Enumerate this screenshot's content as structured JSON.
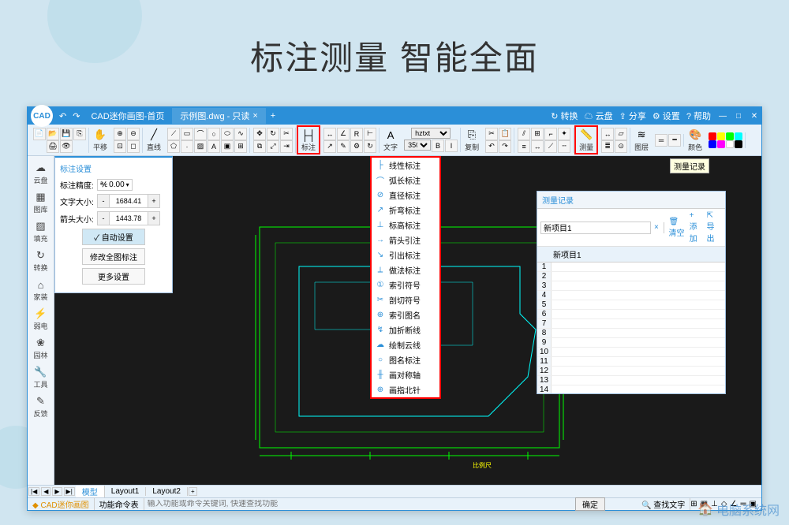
{
  "headline": "标注测量 智能全面",
  "titlebar": {
    "nav_back": "↶",
    "nav_fwd": "↷",
    "tab1": "CAD迷你画图-首页",
    "tab2": "示例图.dwg - 只读",
    "close": "×",
    "tools": {
      "convert": "↻ 转换",
      "cloud": "☁ 云盘",
      "share": "⇪ 分享",
      "settings": "⚙ 设置",
      "help": "? 帮助"
    },
    "win": {
      "min": "—",
      "max": "□",
      "close": "✕"
    }
  },
  "ribbon": {
    "pan": "平移",
    "line": "直线",
    "annotate": "标注",
    "text": "文字",
    "font": "hztxt",
    "size": "350",
    "bold": "B",
    "italic": "I",
    "copy": "复制",
    "measure": "测量",
    "layer": "图层",
    "color": "颜色"
  },
  "sidebar": {
    "items": [
      {
        "icon": "☁",
        "label": "云盘"
      },
      {
        "icon": "▦",
        "label": "图库"
      },
      {
        "icon": "▨",
        "label": "填充"
      },
      {
        "icon": "↻",
        "label": "转换"
      },
      {
        "icon": "⌂",
        "label": "家装"
      },
      {
        "icon": "⚡",
        "label": "弱电"
      },
      {
        "icon": "❀",
        "label": "园林"
      },
      {
        "icon": "🔧",
        "label": "工具"
      },
      {
        "icon": "✎",
        "label": "反馈"
      }
    ]
  },
  "settings_panel": {
    "title": "标注设置",
    "precision_label": "标注精度:",
    "precision_value": "0.00",
    "text_size_label": "文字大小:",
    "text_size_value": "1684.41",
    "arrow_size_label": "箭头大小:",
    "arrow_size_value": "1443.78",
    "auto": "✓ 自动设置",
    "modify": "修改全图标注",
    "more": "更多设置"
  },
  "dropdown": {
    "items": [
      {
        "icon": "├",
        "label": "线性标注"
      },
      {
        "icon": "⌒",
        "label": "弧长标注"
      },
      {
        "icon": "⊘",
        "label": "直径标注"
      },
      {
        "icon": "↗",
        "label": "折弯标注"
      },
      {
        "icon": "⊥",
        "label": "标高标注"
      },
      {
        "icon": "→",
        "label": "箭头引注"
      },
      {
        "icon": "↘",
        "label": "引出标注"
      },
      {
        "icon": "⟂",
        "label": "做法标注"
      },
      {
        "icon": "①",
        "label": "索引符号"
      },
      {
        "icon": "✂",
        "label": "剖切符号"
      },
      {
        "icon": "⊕",
        "label": "索引图名"
      },
      {
        "icon": "↯",
        "label": "加折断线"
      },
      {
        "icon": "☁",
        "label": "绘制云线"
      },
      {
        "icon": "○",
        "label": "图名标注"
      },
      {
        "icon": "╫",
        "label": "画对称轴"
      },
      {
        "icon": "⊕",
        "label": "画指北针"
      }
    ]
  },
  "tooltip": "测量记录",
  "measure_panel": {
    "title": "测量记录",
    "project": "新项目1",
    "clear_icon": "🗑",
    "clear": "清空",
    "add": "+ 添加",
    "export": "⇱ 导出",
    "header": "新项目1",
    "rows": 14
  },
  "bottom_tabs": {
    "model": "模型",
    "layout1": "Layout1",
    "layout2": "Layout2"
  },
  "statusbar": {
    "app": "CAD迷你画图",
    "cmd_label": "功能命令表",
    "placeholder": "输入功能或命令关键词, 快速查找功能",
    "ok": "确定",
    "search": "查找文字"
  },
  "watermark": "电脑系统网"
}
